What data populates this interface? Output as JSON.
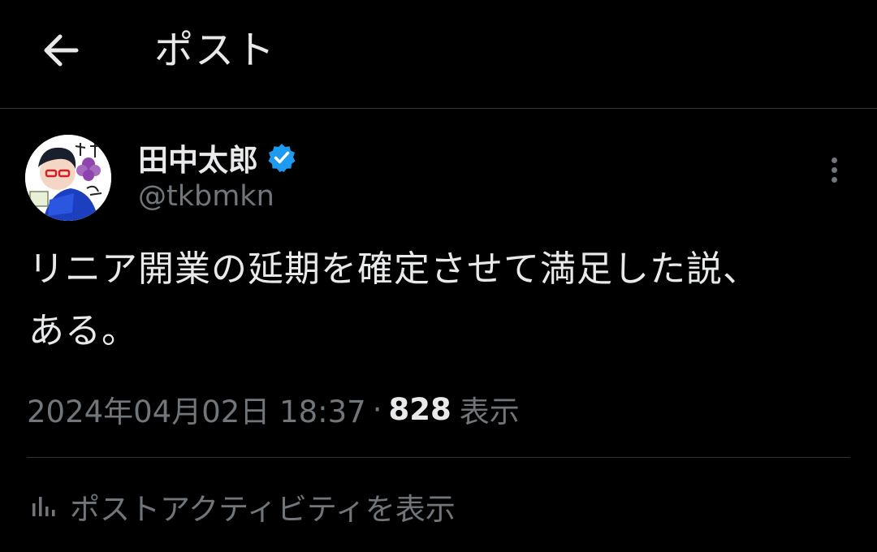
{
  "header": {
    "title": "ポスト",
    "back_icon": "arrow-left-icon"
  },
  "post": {
    "author": {
      "display_name": "田中太郎",
      "handle": "@tkbmkn",
      "verified": true,
      "verified_color": "#1d9bf0"
    },
    "text": "リニア開業の延期を確定させて満足した説、\nある。",
    "timestamp": "2024年04月02日 18:37",
    "separator": "·",
    "views_count": "828",
    "views_label": "表示",
    "activity_label": "ポストアクティビティを表示"
  },
  "colors": {
    "background": "#000000",
    "text_primary": "#e7e9ea",
    "text_secondary": "#71767b",
    "divider": "#2f3336"
  }
}
